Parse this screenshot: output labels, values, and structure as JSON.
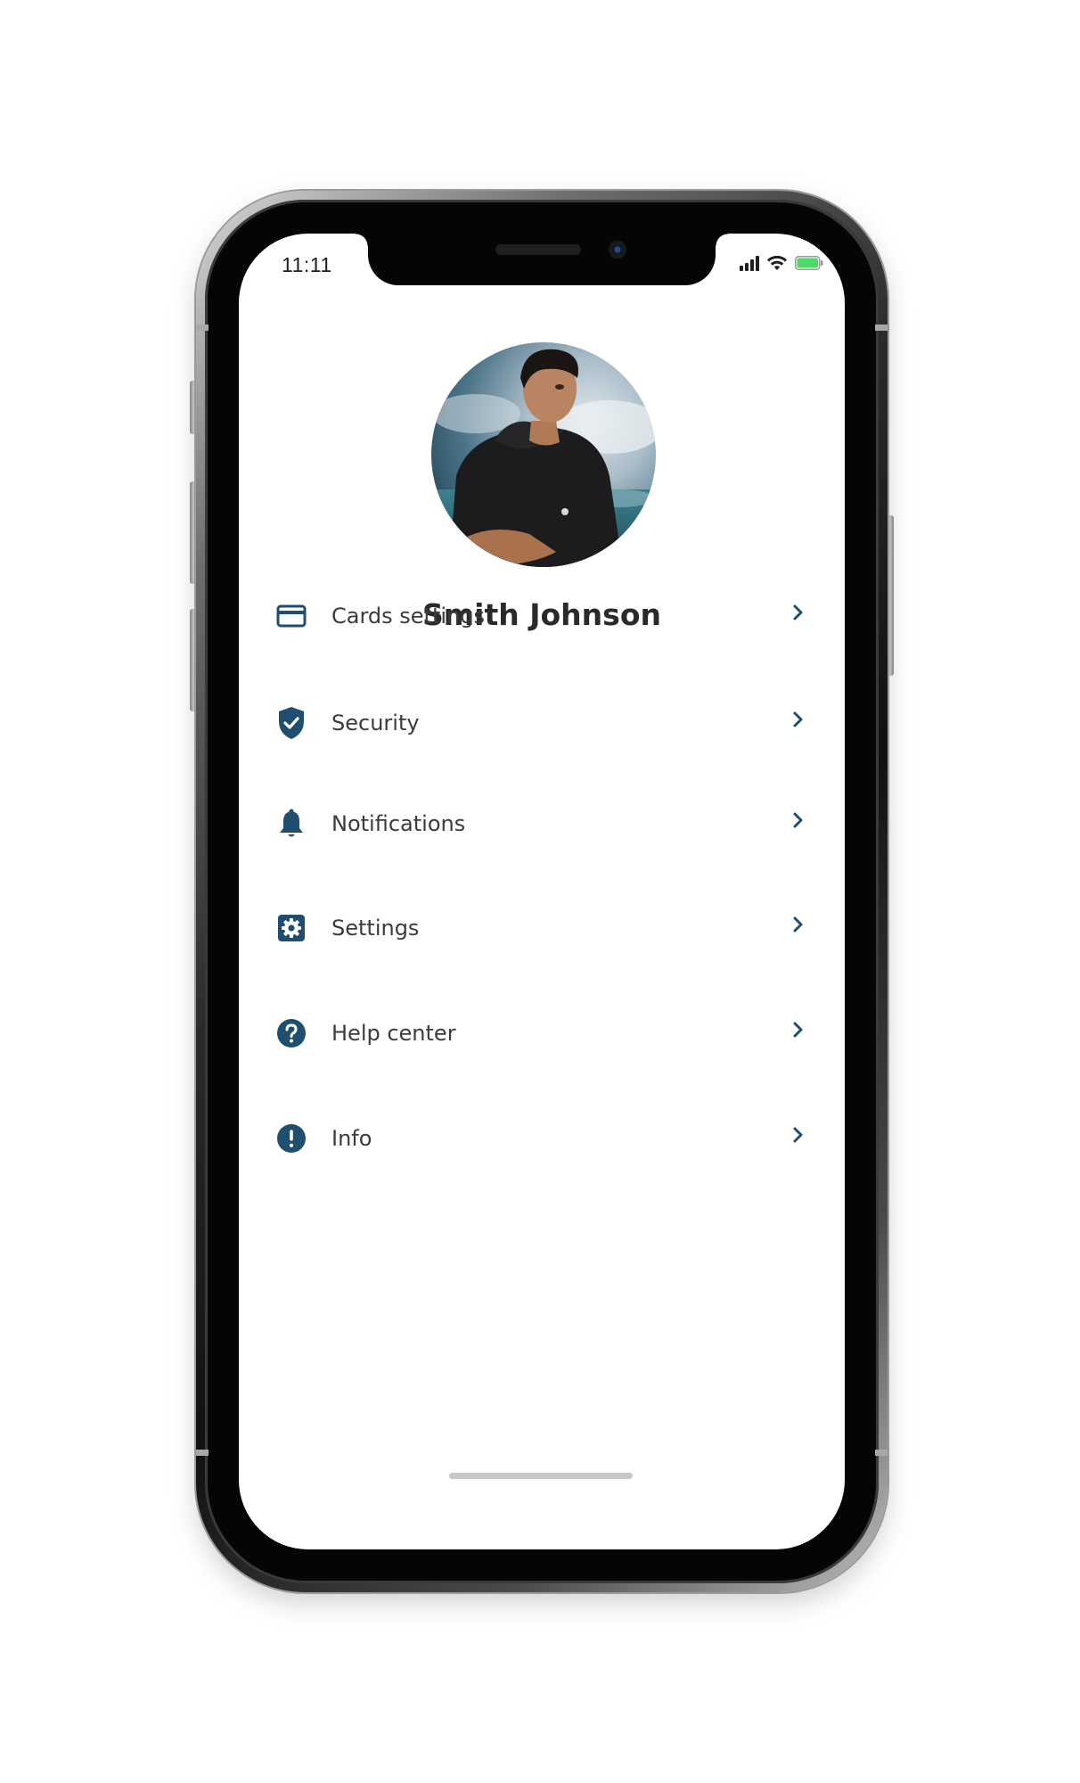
{
  "status_bar": {
    "time": "11:11"
  },
  "profile": {
    "name": "Smith Johnson"
  },
  "menu": {
    "items": [
      {
        "label": "Cards settings",
        "icon": "credit-card-icon"
      },
      {
        "label": "Security",
        "icon": "shield-check-icon"
      },
      {
        "label": "Notifications",
        "icon": "bell-icon"
      },
      {
        "label": "Settings",
        "icon": "gear-icon"
      },
      {
        "label": "Help center",
        "icon": "question-circle-icon"
      },
      {
        "label": "Info",
        "icon": "exclamation-circle-icon"
      }
    ]
  },
  "colors": {
    "accent": "#1f4e6f",
    "text": "#3b3b3b",
    "battery": "#4cd964"
  }
}
